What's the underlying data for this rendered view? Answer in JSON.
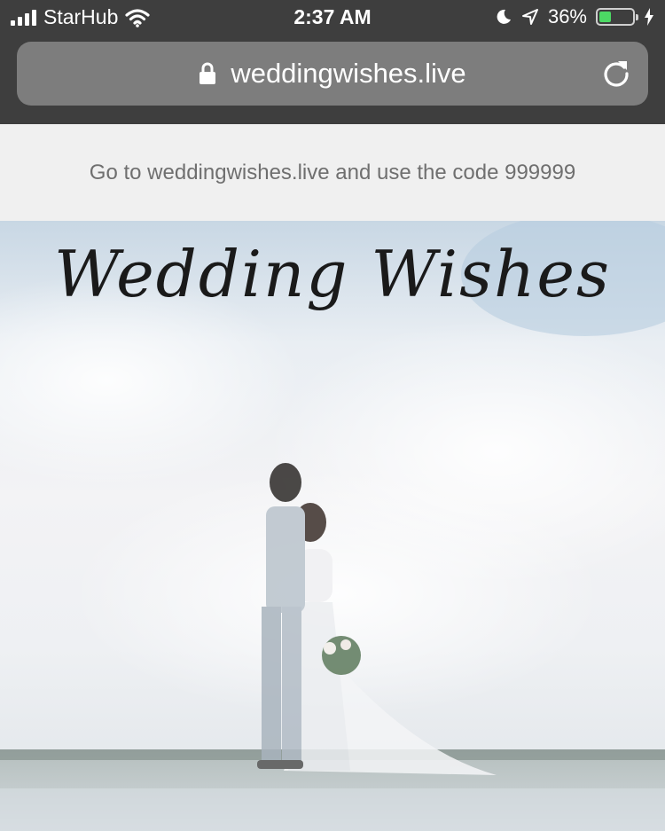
{
  "status_bar": {
    "carrier": "StarHub",
    "time": "2:37 AM",
    "battery_percent_label": "36%",
    "battery_level": 0.36,
    "signal_icon": "cellular-signal-icon",
    "wifi_icon": "wifi-icon",
    "moon_icon": "do-not-disturb-icon",
    "location_icon": "location-arrow-icon",
    "charging_icon": "charging-bolt-icon"
  },
  "browser": {
    "url": "weddingwishes.live",
    "lock_icon": "lock-icon",
    "reload_icon": "reload-icon"
  },
  "banner": {
    "text": "Go to weddingwishes.live and use the code 999999"
  },
  "hero": {
    "title": "Wedding Wishes"
  },
  "colors": {
    "chrome": "#3e3e3e",
    "url_bar": "#7d7d7d",
    "banner_bg": "#f0f0f0",
    "banner_text": "#6f6f6f",
    "battery_green": "#4cd964"
  }
}
